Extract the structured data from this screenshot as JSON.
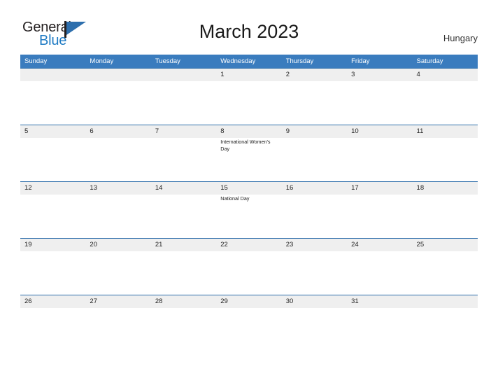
{
  "brand": {
    "name_part1": "General",
    "name_part2": "Blue",
    "flag_icon": "flag-triangle-icon",
    "colors": {
      "dark": "#231F20",
      "blue": "#1F7BC4",
      "flag": "#2E6FAD"
    }
  },
  "header": {
    "title": "March 2023",
    "country": "Hungary"
  },
  "theme": {
    "header_blue": "#3A7CBE",
    "row_divider_blue": "#2F6FAB",
    "date_band_gray": "#EFEFEF",
    "text_dark": "#232323"
  },
  "calendar": {
    "month": "March",
    "year": "2023",
    "weekday_headers": [
      "Sunday",
      "Monday",
      "Tuesday",
      "Wednesday",
      "Thursday",
      "Friday",
      "Saturday"
    ],
    "weeks": [
      [
        {
          "day": "",
          "event": ""
        },
        {
          "day": "",
          "event": ""
        },
        {
          "day": "",
          "event": ""
        },
        {
          "day": "1",
          "event": ""
        },
        {
          "day": "2",
          "event": ""
        },
        {
          "day": "3",
          "event": ""
        },
        {
          "day": "4",
          "event": ""
        }
      ],
      [
        {
          "day": "5",
          "event": ""
        },
        {
          "day": "6",
          "event": ""
        },
        {
          "day": "7",
          "event": ""
        },
        {
          "day": "8",
          "event": "International Women's Day"
        },
        {
          "day": "9",
          "event": ""
        },
        {
          "day": "10",
          "event": ""
        },
        {
          "day": "11",
          "event": ""
        }
      ],
      [
        {
          "day": "12",
          "event": ""
        },
        {
          "day": "13",
          "event": ""
        },
        {
          "day": "14",
          "event": ""
        },
        {
          "day": "15",
          "event": "National Day"
        },
        {
          "day": "16",
          "event": ""
        },
        {
          "day": "17",
          "event": ""
        },
        {
          "day": "18",
          "event": ""
        }
      ],
      [
        {
          "day": "19",
          "event": ""
        },
        {
          "day": "20",
          "event": ""
        },
        {
          "day": "21",
          "event": ""
        },
        {
          "day": "22",
          "event": ""
        },
        {
          "day": "23",
          "event": ""
        },
        {
          "day": "24",
          "event": ""
        },
        {
          "day": "25",
          "event": ""
        }
      ],
      [
        {
          "day": "26",
          "event": ""
        },
        {
          "day": "27",
          "event": ""
        },
        {
          "day": "28",
          "event": ""
        },
        {
          "day": "29",
          "event": ""
        },
        {
          "day": "30",
          "event": ""
        },
        {
          "day": "31",
          "event": ""
        },
        {
          "day": "",
          "event": ""
        }
      ]
    ]
  }
}
